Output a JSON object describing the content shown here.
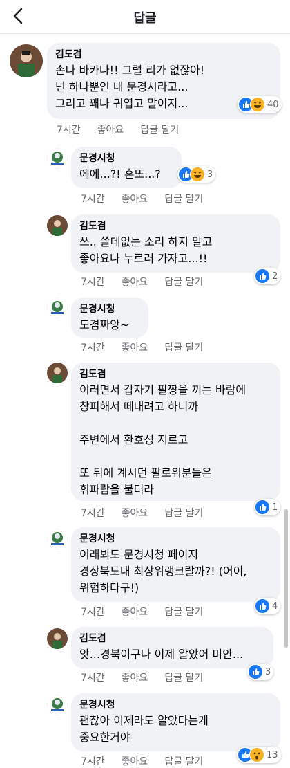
{
  "header": {
    "title": "답글"
  },
  "actions": {
    "time": "7시간",
    "like": "좋아요",
    "reply": "답글 달기"
  },
  "comments": [
    {
      "author": "김도겸",
      "lines": [
        "손나 바카나!! 그럴 리가 없잖아!",
        "넌 하나뿐인 내 문경시라고...",
        "그리고 꽤나 귀엽고 말이지..."
      ],
      "reactions": [
        "like",
        "haha"
      ],
      "count": "40"
    },
    {
      "author": "문경시청",
      "lines": [
        "에에...?! 혼또...?"
      ],
      "reactions": [
        "like",
        "haha"
      ],
      "count": "3"
    },
    {
      "author": "김도겸",
      "lines": [
        "쓰.. 쓸데없는 소리 하지 말고",
        "좋아요나 누르러 가자고...!!"
      ],
      "reactions": [
        "like"
      ],
      "count": "2"
    },
    {
      "author": "문경시청",
      "lines": [
        "도겸짜앙~"
      ],
      "reactions": [],
      "count": ""
    },
    {
      "author": "김도겸",
      "lines": [
        "이러면서 갑자기 팔짱을 끼는 바람에",
        "창피해서 떼내려고 하니까",
        "",
        "주변에서 환호성 지르고",
        "",
        "또 뒤에 계시던 팔로워분들은",
        "휘파람을 불더라"
      ],
      "reactions": [
        "like"
      ],
      "count": "1"
    },
    {
      "author": "문경시청",
      "lines": [
        "이래뵈도 문경시청 페이지",
        "경상북도내 최상위랭크랄까?! (어이,",
        "위험하다구!)"
      ],
      "reactions": [
        "like"
      ],
      "count": "4"
    },
    {
      "author": "김도겸",
      "lines": [
        "앗...경북이구나 이제 알았어 미안..."
      ],
      "reactions": [
        "like"
      ],
      "count": "3"
    },
    {
      "author": "문경시청",
      "lines": [
        "괜찮아 이제라도 알았다는게",
        "중요한거야"
      ],
      "reactions": [
        "like",
        "wow"
      ],
      "count": "13"
    }
  ]
}
